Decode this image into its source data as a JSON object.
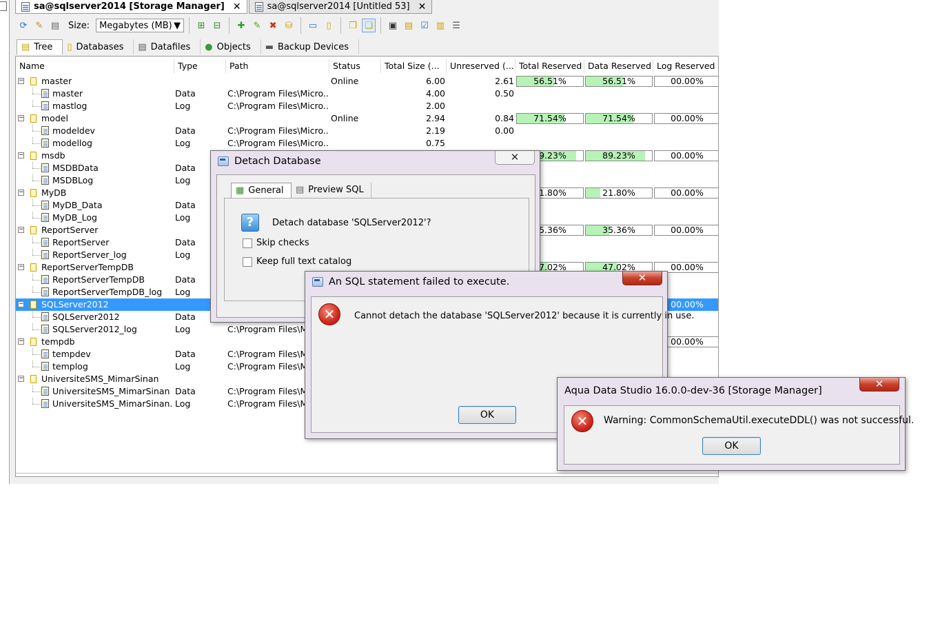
{
  "doc_tabs": [
    {
      "label": "sa@sqlserver2014 [Storage Manager]",
      "close": "✕"
    },
    {
      "label": "sa@sqlserver2014 [Untitled 53]",
      "close": "✕"
    }
  ],
  "toolbar": {
    "size_label": "Size:",
    "size_value": "Megabytes (MB)"
  },
  "view_tabs": [
    "Tree",
    "Databases",
    "Datafiles",
    "Objects",
    "Backup Devices"
  ],
  "columns": [
    "Name",
    "Type",
    "Path",
    "Status",
    "Total Size (...",
    "Unreserved (...",
    "Total Reserved",
    "Data Reserved",
    "Log Reserved"
  ],
  "rows": [
    {
      "level": 0,
      "name": "master",
      "type": "",
      "path": "",
      "status": "Online",
      "total": "6.00",
      "unres": "2.61",
      "tr": "56.51%",
      "trf": 0.5651,
      "dr": "56.51%",
      "drf": 0.5651,
      "lr": "00.00%"
    },
    {
      "level": 1,
      "name": "master",
      "type": "Data",
      "path": "C:\\Program Files\\Micro...",
      "status": "",
      "total": "4.00",
      "unres": "0.50",
      "tr": "",
      "dr": "",
      "lr": ""
    },
    {
      "level": 1,
      "name": "mastlog",
      "type": "Log",
      "path": "C:\\Program Files\\Micro...",
      "status": "",
      "total": "2.00",
      "unres": "",
      "tr": "",
      "dr": "",
      "lr": ""
    },
    {
      "level": 0,
      "name": "model",
      "type": "",
      "path": "",
      "status": "Online",
      "total": "2.94",
      "unres": "0.84",
      "tr": "71.54%",
      "trf": 0.7154,
      "dr": "71.54%",
      "drf": 0.7154,
      "lr": "00.00%"
    },
    {
      "level": 1,
      "name": "modeldev",
      "type": "Data",
      "path": "C:\\Program Files\\Micro...",
      "status": "",
      "total": "2.19",
      "unres": "0.00",
      "tr": "",
      "dr": "",
      "lr": ""
    },
    {
      "level": 1,
      "name": "modellog",
      "type": "Log",
      "path": "C:\\Program Files\\Micro...",
      "status": "",
      "total": "0.75",
      "unres": "",
      "tr": "",
      "dr": "",
      "lr": ""
    },
    {
      "level": 0,
      "name": "msdb",
      "type": "",
      "path": "",
      "status": "",
      "total": "",
      "unres": "",
      "tr": "89.23%",
      "trf": 0.8923,
      "dr": "89.23%",
      "drf": 0.8923,
      "lr": "00.00%"
    },
    {
      "level": 1,
      "name": "MSDBData",
      "type": "Data",
      "path": "",
      "status": "",
      "total": "",
      "unres": "",
      "tr": "",
      "dr": "",
      "lr": ""
    },
    {
      "level": 1,
      "name": "MSDBLog",
      "type": "Log",
      "path": "",
      "status": "",
      "total": "",
      "unres": "",
      "tr": "",
      "dr": "",
      "lr": ""
    },
    {
      "level": 0,
      "name": "MyDB",
      "type": "",
      "path": "",
      "status": "",
      "total": "",
      "unres": "",
      "tr": "21.80%",
      "trf": 0.218,
      "dr": "21.80%",
      "drf": 0.218,
      "lr": "00.00%"
    },
    {
      "level": 1,
      "name": "MyDB_Data",
      "type": "Data",
      "path": "",
      "status": "",
      "total": "",
      "unres": "",
      "tr": "",
      "dr": "",
      "lr": ""
    },
    {
      "level": 1,
      "name": "MyDB_Log",
      "type": "Log",
      "path": "",
      "status": "",
      "total": "",
      "unres": "",
      "tr": "",
      "dr": "",
      "lr": ""
    },
    {
      "level": 0,
      "name": "ReportServer",
      "type": "",
      "path": "",
      "status": "",
      "total": "",
      "unres": "",
      "tr": "35.36%",
      "trf": 0.3536,
      "dr": "35.36%",
      "drf": 0.3536,
      "lr": "00.00%"
    },
    {
      "level": 1,
      "name": "ReportServer",
      "type": "Data",
      "path": "",
      "status": "",
      "total": "",
      "unres": "",
      "tr": "",
      "dr": "",
      "lr": ""
    },
    {
      "level": 1,
      "name": "ReportServer_log",
      "type": "Log",
      "path": "",
      "status": "",
      "total": "",
      "unres": "",
      "tr": "",
      "dr": "",
      "lr": ""
    },
    {
      "level": 0,
      "name": "ReportServerTempDB",
      "type": "",
      "path": "",
      "status": "",
      "total": "",
      "unres": "",
      "tr": "47.02%",
      "trf": 0.4702,
      "dr": "47.02%",
      "drf": 0.4702,
      "lr": "00.00%"
    },
    {
      "level": 1,
      "name": "ReportServerTempDB",
      "type": "Data",
      "path": "",
      "status": "",
      "total": "",
      "unres": "",
      "tr": "",
      "dr": "",
      "lr": ""
    },
    {
      "level": 1,
      "name": "ReportServerTempDB_log",
      "type": "Log",
      "path": "",
      "status": "",
      "total": "",
      "unres": "",
      "tr": "",
      "dr": "",
      "lr": ""
    },
    {
      "level": 0,
      "name": "SQLServer2012",
      "type": "",
      "path": "",
      "status": "",
      "total": "",
      "unres": "",
      "tr": "",
      "dr": "",
      "lr": "00.00%",
      "selected": true
    },
    {
      "level": 1,
      "name": "SQLServer2012",
      "type": "Data",
      "path": "",
      "status": "",
      "total": "",
      "unres": "",
      "tr": "",
      "dr": "",
      "lr": ""
    },
    {
      "level": 1,
      "name": "SQLServer2012_log",
      "type": "Log",
      "path": "C:\\Program Files\\Mi",
      "status": "",
      "total": "",
      "unres": "",
      "tr": "",
      "dr": "",
      "lr": ""
    },
    {
      "level": 0,
      "name": "tempdb",
      "type": "",
      "path": "",
      "status": "",
      "total": "",
      "unres": "",
      "tr": "",
      "dr": "",
      "lr": "00.00%"
    },
    {
      "level": 1,
      "name": "tempdev",
      "type": "Data",
      "path": "C:\\Program Files\\Mi",
      "status": "",
      "total": "",
      "unres": "",
      "tr": "",
      "dr": "",
      "lr": ""
    },
    {
      "level": 1,
      "name": "templog",
      "type": "Log",
      "path": "C:\\Program Files\\Mi",
      "status": "",
      "total": "",
      "unres": "",
      "tr": "",
      "dr": "",
      "lr": ""
    },
    {
      "level": 0,
      "name": "UniversiteSMS_MimarSinan",
      "type": "",
      "path": "",
      "status": "",
      "total": "",
      "unres": "",
      "tr": "",
      "dr": "",
      "lr": ""
    },
    {
      "level": 1,
      "name": "UniversiteSMS_MimarSinan",
      "type": "Data",
      "path": "C:\\Program Files\\Mi",
      "status": "",
      "total": "",
      "unres": "",
      "tr": "",
      "dr": "",
      "lr": ""
    },
    {
      "level": 1,
      "name": "UniversiteSMS_MimarSinan...",
      "type": "Log",
      "path": "C:\\Program Files\\Mi",
      "status": "",
      "total": "",
      "unres": "",
      "tr": "",
      "dr": "",
      "lr": ""
    }
  ],
  "detach_dialog": {
    "title": "Detach Database",
    "tabs": [
      "General",
      "Preview SQL"
    ],
    "question": "Detach database 'SQLServer2012'?",
    "skip_checks": "Skip checks",
    "keep_catalog": "Keep full text catalog",
    "close": "✕"
  },
  "sql_error_dialog": {
    "title": "An SQL statement failed to execute.",
    "message": "Cannot detach the database 'SQLServer2012' because it is currently in use.",
    "ok": "OK",
    "close": "✕",
    "icon": "✕"
  },
  "warning_dialog": {
    "title": "Aqua Data Studio 16.0.0-dev-36 [Storage Manager]",
    "message": "Warning: CommonSchemaUtil.executeDDL() was not successful.",
    "ok": "OK",
    "close": "✕",
    "icon": "✕"
  },
  "icons": {
    "q_icon": "?"
  },
  "colors": {
    "selection": "#3399ff",
    "pct_fill": "#b7f2b7",
    "error_red": "#d2281b"
  }
}
